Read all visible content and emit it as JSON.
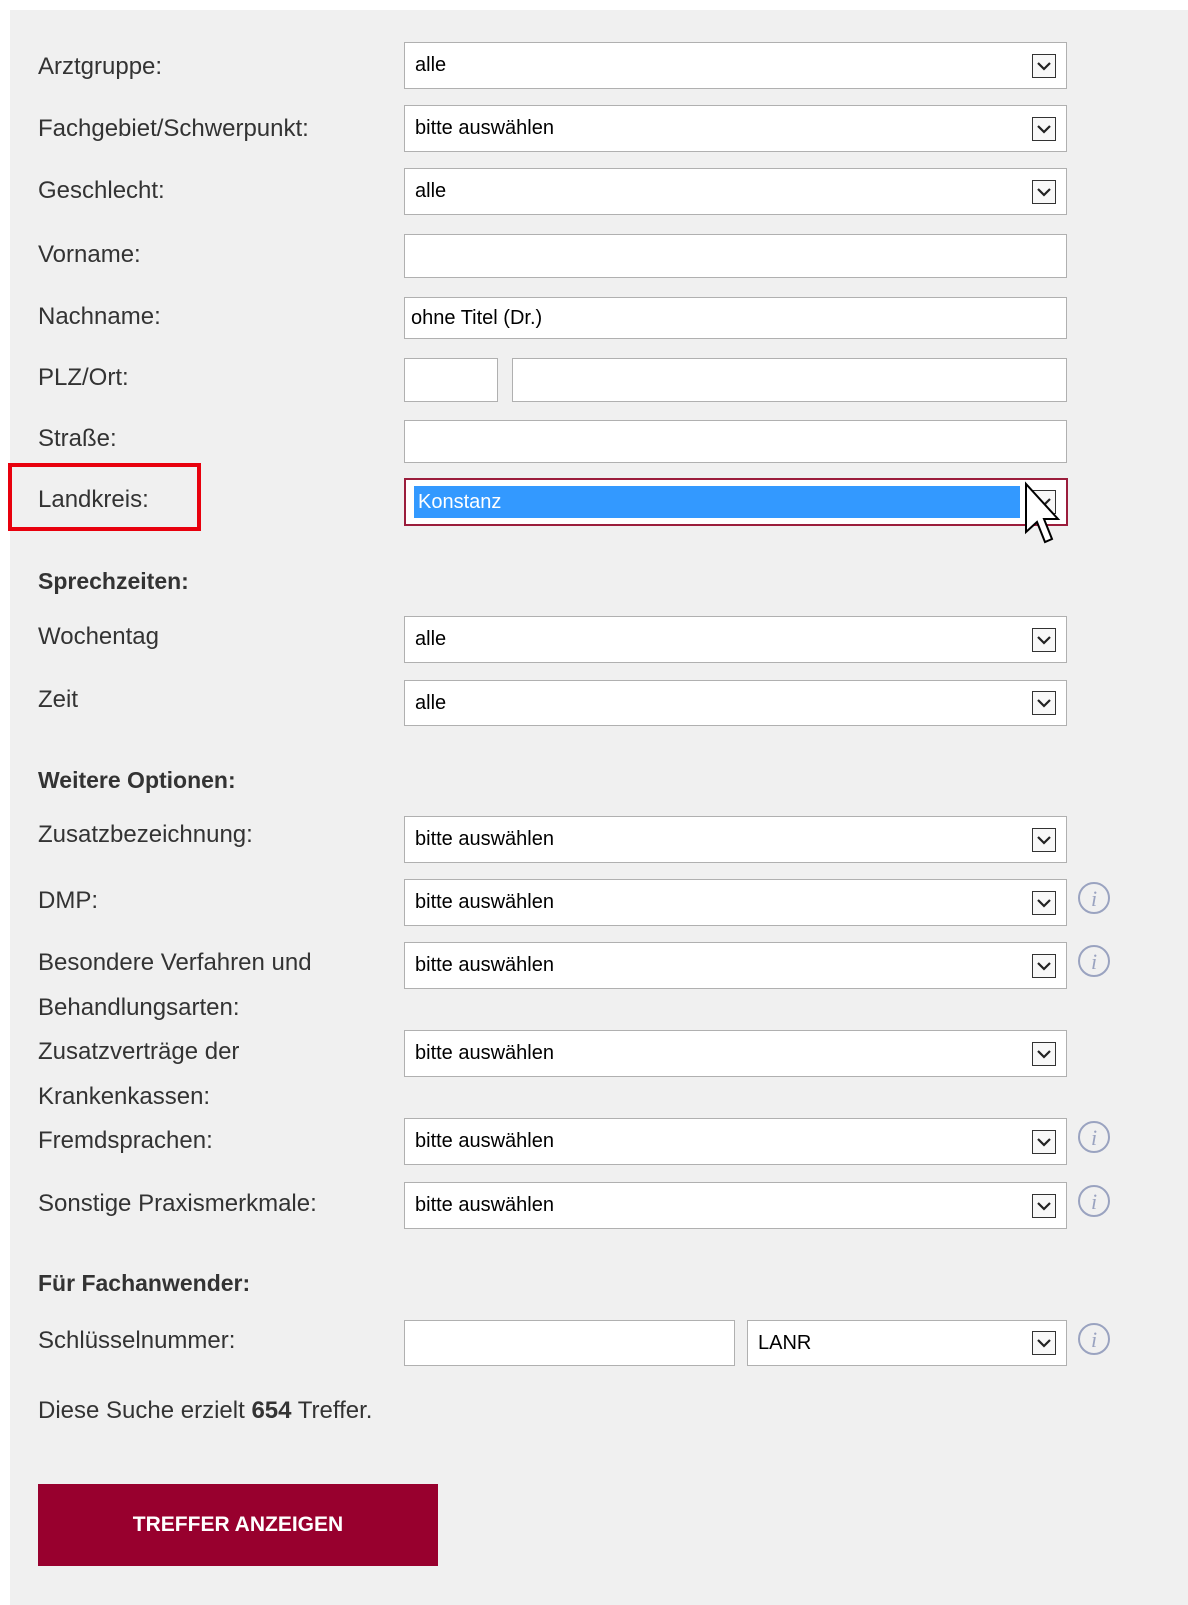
{
  "form": {
    "fields": [
      {
        "label": "Arztgruppe:",
        "value": "alle"
      },
      {
        "label": "Fachgebiet/Schwerpunkt:",
        "value": "bitte auswählen"
      },
      {
        "label": "Geschlecht:",
        "value": "alle"
      },
      {
        "label": "Vorname:",
        "value": ""
      },
      {
        "label": "Nachname:",
        "value": "ohne Titel (Dr.)"
      },
      {
        "label": "PLZ/Ort:",
        "plz": "",
        "ort": ""
      },
      {
        "label": "Straße:",
        "value": ""
      },
      {
        "label": "Landkreis:",
        "value": "Konstanz"
      }
    ]
  },
  "sprechzeiten": {
    "heading": "Sprechzeiten:",
    "fields": [
      {
        "label": "Wochentag",
        "value": "alle"
      },
      {
        "label": "Zeit",
        "value": "alle"
      }
    ]
  },
  "optionen": {
    "heading": "Weitere Optionen:",
    "fields": [
      {
        "label": "Zusatzbezeichnung:",
        "value": "bitte auswählen"
      },
      {
        "label": "DMP:",
        "value": "bitte auswählen"
      },
      {
        "label_line1": "Besondere Verfahren und",
        "label_line2": "Behandlungsarten:",
        "value": "bitte auswählen"
      },
      {
        "label_line1": "Zusatzverträge der",
        "label_line2": "Krankenkassen:",
        "value": "bitte auswählen"
      },
      {
        "label": "Fremdsprachen:",
        "value": "bitte auswählen"
      },
      {
        "label": "Sonstige Praxismerkmale:",
        "value": "bitte auswählen"
      }
    ]
  },
  "fachanwender": {
    "heading": "Für Fachanwender:",
    "label": "Schlüsselnummer:",
    "input_value": "",
    "select_value": "LANR"
  },
  "result": {
    "prefix": "Diese Suche erzielt",
    "count": "654",
    "suffix": "Treffer."
  },
  "submit_label": "TREFFER ANZEIGEN",
  "icons": {
    "dropdown": "chevron-down-icon",
    "info": "info-icon",
    "cursor": "mouse-pointer-icon"
  },
  "colors": {
    "background": "#f0f0f0",
    "button": "#98002e",
    "selection": "#3399ff",
    "focus_border": "#9b1d3c",
    "annotation": "#e8000d",
    "info_icon": "#9aa3c0"
  }
}
